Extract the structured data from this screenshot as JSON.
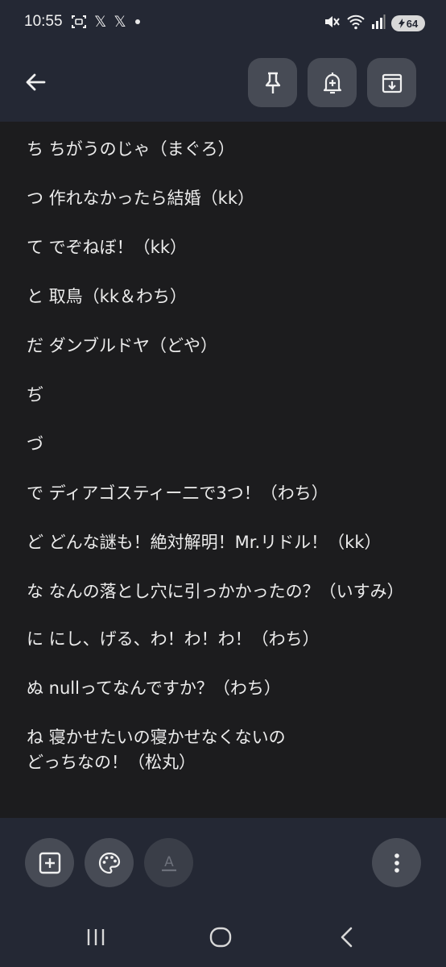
{
  "status_bar": {
    "time": "10:55",
    "left_icons": [
      "screenshot-icon",
      "x-logo-icon",
      "x-logo-icon",
      "notification-dot"
    ],
    "x_glyph": "𝕏",
    "right_icons": [
      "mute-icon",
      "wifi-icon",
      "signal-icon"
    ],
    "battery_level": "64"
  },
  "toolbar": {
    "back_icon": "arrow-back-icon",
    "actions": [
      "pin-icon",
      "add-reminder-icon",
      "archive-icon"
    ]
  },
  "note": {
    "lines": [
      "ち ちがうのじゃ（まぐろ）",
      "つ 作れなかったら結婚（kk）",
      "て でぞねぼ！（kk）",
      "と 取鳥（kk＆わち）",
      "だ ダンブルドヤ（どや）",
      "ぢ",
      "づ",
      "で ディアゴスティー二で3つ！（わち）",
      "ど どんな謎も！絶対解明！Mr.リドル！（kk）",
      "な なんの落とし穴に引っかかったの？（いすみ）",
      "に にし、げる、わ！わ！わ！（わち）",
      "ぬ nullってなんですか？（わち）",
      "ね 寝かせたいの寝かせなくないの\nどっちなの！（松丸）"
    ]
  },
  "bottom_bar": {
    "buttons": [
      "add-box-icon",
      "palette-icon",
      "text-format-icon",
      "more-vert-icon"
    ],
    "format_letter": "A"
  },
  "nav_bar": {
    "buttons": [
      "recent-apps-icon",
      "home-icon",
      "back-icon"
    ]
  },
  "colors": {
    "top_bar": "#242834",
    "note_bg": "#1c1c1e",
    "button_bg": "#474b55",
    "text": "#ececec"
  }
}
